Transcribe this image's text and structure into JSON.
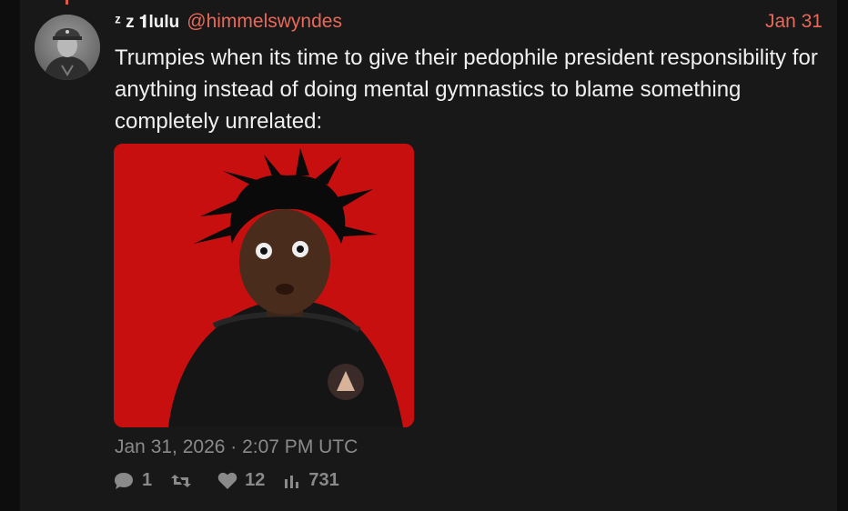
{
  "post": {
    "display_name": "ᶻ z 𝟏lulu",
    "handle": "@himmelswyndes",
    "date": "Jan 31",
    "text": "Trumpies when its time to give their pedophile president responsibility for anything instead of doing mental gymnastics to blame something completely unrelated:",
    "timestamp": "Jan 31, 2026 · 2:07 PM UTC"
  },
  "stats": {
    "replies": "1",
    "retweets": "",
    "likes": "12",
    "views": "731"
  },
  "colors": {
    "accent": "#e8695a",
    "background": "#181818",
    "muted": "#8a8a8a",
    "media_bg": "#c80f0f"
  },
  "icons": {
    "reply": "comment-icon",
    "retweet": "retweet-icon",
    "like": "heart-icon",
    "views": "bar-chart-icon"
  }
}
